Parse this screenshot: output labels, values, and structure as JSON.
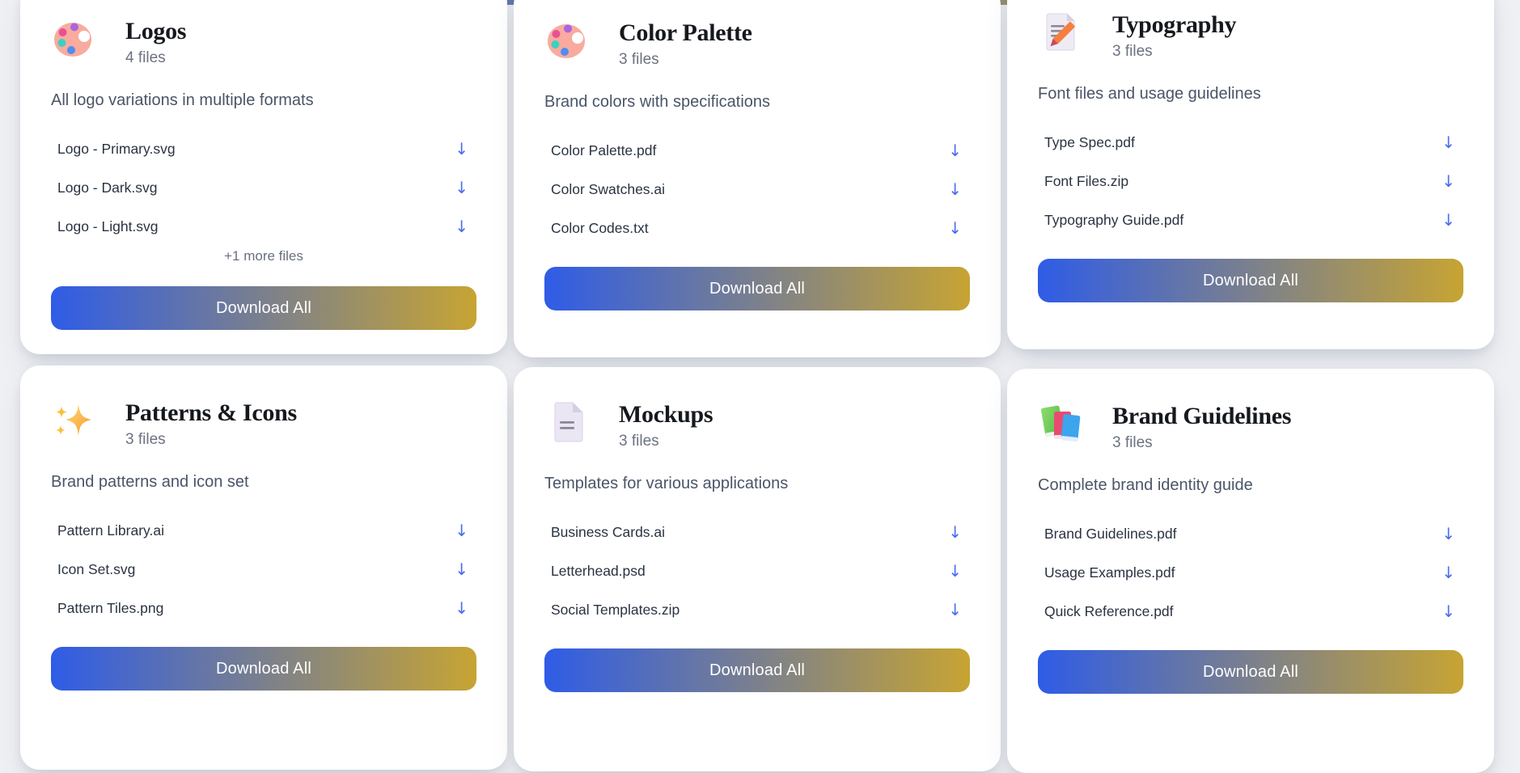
{
  "page": {
    "background_color": "#eff0f3",
    "accent_gradient": {
      "from": "#2f5ce7",
      "to": "#c7a433"
    }
  },
  "icons": {
    "download_arrow": "↓"
  },
  "cards": [
    {
      "icon": "palette-icon",
      "title": "Logos",
      "file_count": "4 files",
      "description": "All logo variations in multiple formats",
      "files": [
        "Logo - Primary.svg",
        "Logo - Dark.svg",
        "Logo - Light.svg"
      ],
      "more_files": "+1 more files",
      "download_label": "Download All"
    },
    {
      "icon": "palette-icon",
      "title": "Color Palette",
      "file_count": "3 files",
      "description": "Brand colors with specifications",
      "files": [
        "Color Palette.pdf",
        "Color Swatches.ai",
        "Color Codes.txt"
      ],
      "download_label": "Download All"
    },
    {
      "icon": "memo-icon",
      "title": "Typography",
      "file_count": "3 files",
      "description": "Font files and usage guidelines",
      "files": [
        "Type Spec.pdf",
        "Font Files.zip",
        "Typography Guide.pdf"
      ],
      "download_label": "Download All"
    },
    {
      "icon": "sparkles-icon",
      "title": "Patterns & Icons",
      "file_count": "3 files",
      "description": "Brand patterns and icon set",
      "files": [
        "Pattern Library.ai",
        "Icon Set.svg",
        "Pattern Tiles.png"
      ],
      "download_label": "Download All"
    },
    {
      "icon": "page-icon",
      "title": "Mockups",
      "file_count": "3 files",
      "description": "Templates for various applications",
      "files": [
        "Business Cards.ai",
        "Letterhead.psd",
        "Social Templates.zip"
      ],
      "download_label": "Download All"
    },
    {
      "icon": "books-icon",
      "title": "Brand Guidelines",
      "file_count": "3 files",
      "description": "Complete brand identity guide",
      "files": [
        "Brand Guidelines.pdf",
        "Usage Examples.pdf",
        "Quick Reference.pdf"
      ],
      "download_label": "Download All"
    }
  ]
}
